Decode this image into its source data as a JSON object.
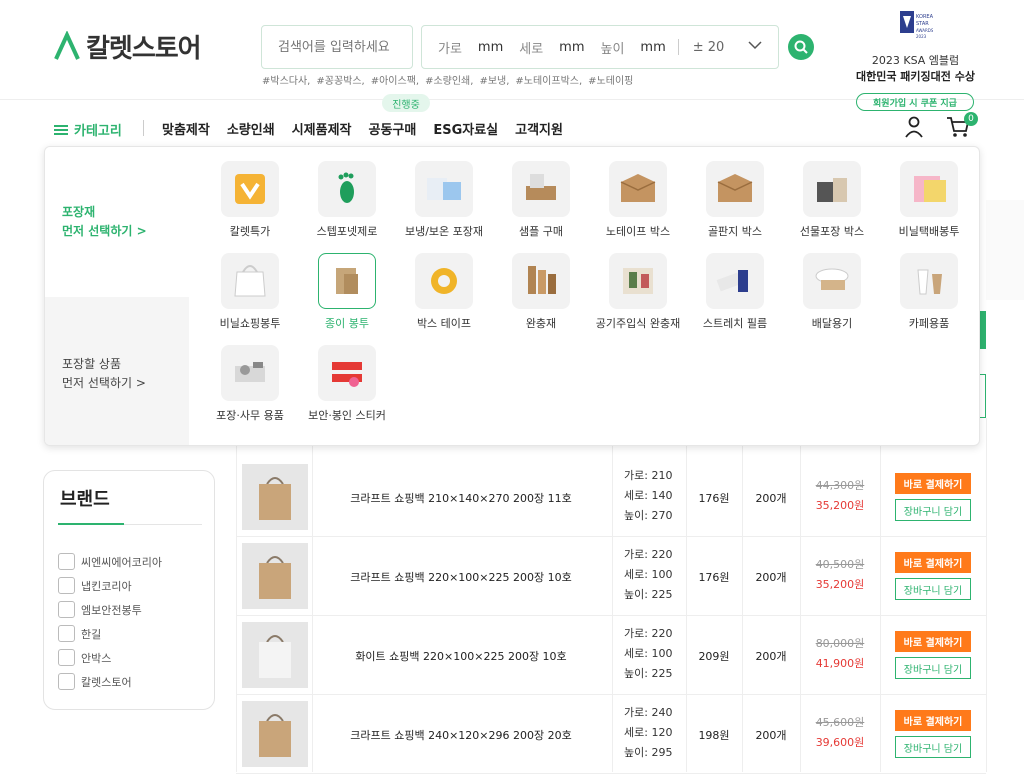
{
  "brand": {
    "name": "칼렛스토어"
  },
  "search": {
    "placeholder": "검색어를 입력하세요"
  },
  "dims": {
    "w_label": "가로",
    "h_label": "세로",
    "d_label": "높이",
    "unit": "mm",
    "tolerance": "± 20"
  },
  "tags": [
    "#박스다사,",
    "#꽁꽁박스,",
    "#아이스팩,",
    "#소량인쇄,",
    "#보냉,",
    "#노테이프박스,",
    "#노테이핑"
  ],
  "award": {
    "emblem_text": "KOREA STAR AWARDS 2023",
    "line1": "2023 KSA 엠블럼",
    "line2": "대한민국 패키징대전 수상"
  },
  "nav": {
    "category_label": "카테고리",
    "items": [
      "맞춤제작",
      "소량인쇄",
      "시제품제작",
      "공동구매",
      "ESG자료실",
      "고객지원"
    ],
    "badge": "진행중",
    "coupon": "회원가입 시 쿠폰 지급",
    "cart_count": "0"
  },
  "dropdown": {
    "left1": {
      "line1": "포장재",
      "line2": "먼저 선택하기 >"
    },
    "left2": {
      "line1": "포장할 상품",
      "line2": "먼저 선택하기 >"
    },
    "categories": [
      {
        "label": "칼렛특가",
        "icon": "sale-icon"
      },
      {
        "label": "스텝포넷제로",
        "icon": "footprint-icon"
      },
      {
        "label": "보냉/보온 포장재",
        "icon": "cooler-icon"
      },
      {
        "label": "샘플 구매",
        "icon": "sample-icon"
      },
      {
        "label": "노테이프 박스",
        "icon": "box-icon"
      },
      {
        "label": "골판지 박스",
        "icon": "box-icon"
      },
      {
        "label": "선물포장 박스",
        "icon": "gift-box-icon"
      },
      {
        "label": "비닐택배봉투",
        "icon": "mailer-bag-icon"
      },
      {
        "label": "비닐쇼핑봉투",
        "icon": "plastic-bag-icon"
      },
      {
        "label": "종이 봉투",
        "icon": "paper-bag-icon",
        "selected": true
      },
      {
        "label": "박스 테이프",
        "icon": "tape-icon"
      },
      {
        "label": "완충재",
        "icon": "cushion-icon"
      },
      {
        "label": "공기주입식 완충재",
        "icon": "air-cushion-icon"
      },
      {
        "label": "스트레치 필름",
        "icon": "film-icon"
      },
      {
        "label": "배달용기",
        "icon": "container-icon"
      },
      {
        "label": "카페용품",
        "icon": "cup-icon"
      },
      {
        "label": "포장·사무 용품",
        "icon": "dispenser-icon"
      },
      {
        "label": "보안·봉인 스티커",
        "icon": "sticker-icon"
      }
    ]
  },
  "brand_filter": {
    "title": "브랜드",
    "items": [
      "씨엔씨에어코리아",
      "냅킨코리아",
      "엠보안전봉투",
      "한길",
      "안박스",
      "칼렛스토어"
    ]
  },
  "products": [
    {
      "name": "크라프트 쇼핑백 210×140×270 200장 11호",
      "w": "가로: 210",
      "h": "세로: 140",
      "d": "높이: 270",
      "unit_price": "176원",
      "qty": "200개",
      "old_price": "44,300원",
      "price": "35,200원",
      "buy": "바로 결제하기",
      "cart": "장바구니 담기",
      "color": "#c9a57a"
    },
    {
      "name": "크라프트 쇼핑백 220×100×225 200장 10호",
      "w": "가로: 220",
      "h": "세로: 100",
      "d": "높이: 225",
      "unit_price": "176원",
      "qty": "200개",
      "old_price": "40,500원",
      "price": "35,200원",
      "buy": "바로 결제하기",
      "cart": "장바구니 담기",
      "color": "#c9a57a"
    },
    {
      "name": "화이트 쇼핑백 220×100×225 200장 10호",
      "w": "가로: 220",
      "h": "세로: 100",
      "d": "높이: 225",
      "unit_price": "209원",
      "qty": "200개",
      "old_price": "80,000원",
      "price": "41,900원",
      "buy": "바로 결제하기",
      "cart": "장바구니 담기",
      "color": "#f4f4f4"
    },
    {
      "name": "크라프트 쇼핑백 240×120×296 200장 20호",
      "w": "가로: 240",
      "h": "세로: 120",
      "d": "높이: 295",
      "unit_price": "198원",
      "qty": "200개",
      "old_price": "45,600원",
      "price": "39,600원",
      "buy": "바로 결제하기",
      "cart": "장바구니 담기",
      "color": "#c9a57a"
    }
  ]
}
